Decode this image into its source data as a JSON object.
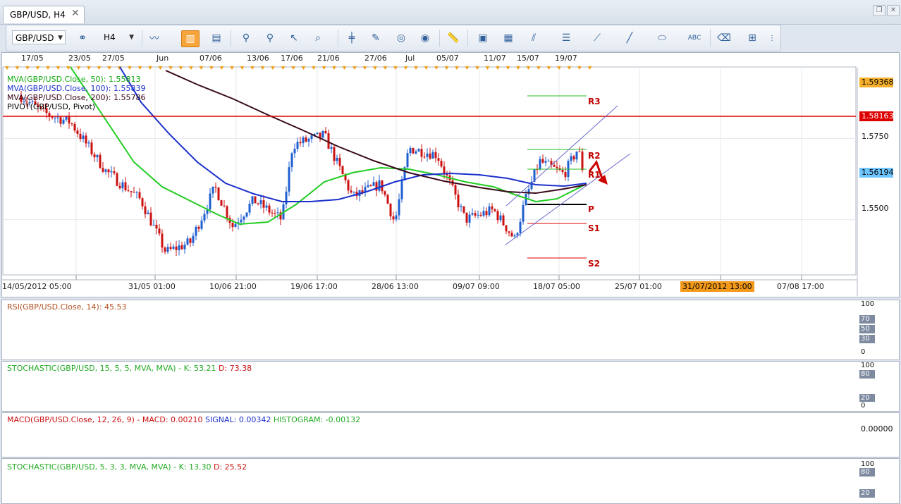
{
  "window": {
    "tab_title": "GBP/USD, H4",
    "tab_close": "✕"
  },
  "toolbar": {
    "instrument": "GBP/USD",
    "timeframe": "H4",
    "icons": [
      "link-icon",
      "chart-type-icon",
      "candles-icon",
      "bars-icon",
      "magnet-icon",
      "magnet-off-icon",
      "cursor-icon",
      "zoom-icon",
      "crosshair-icon",
      "pen-icon",
      "layers-icon",
      "globe-icon",
      "ruler-icon",
      "image-icon",
      "screenshot-icon",
      "trend-tool-icon",
      "channel-tool-icon",
      "fan-tool-icon",
      "line-tool-icon",
      "ellipse-tool-icon",
      "text-tool-icon",
      "eraser-icon",
      "tree-icon"
    ]
  },
  "main_chart": {
    "top_dates": [
      "17/05",
      "23/05",
      "27/05",
      "Jun",
      "07/06",
      "13/06",
      "17/06",
      "21/06",
      "27/06",
      "Jul",
      "05/07",
      "11/07",
      "15/07",
      "19/07"
    ],
    "bottom_dates": [
      "14/05/2012 05:00",
      "31/05 01:00",
      "10/06 21:00",
      "19/06 17:00",
      "28/06 13:00",
      "09/07 09:00",
      "18/07 05:00",
      "25/07 01:00",
      "07/08 17:00"
    ],
    "current_time_label": "31/07/2012 13:00",
    "legend": [
      {
        "text": "MVA(GBP/USD.Close, 50): 1.55813",
        "color": "#00aa00"
      },
      {
        "text": "MVA(GBP/USD.Close, 100): 1.55839",
        "color": "#0000aa"
      },
      {
        "text": "MVA(GBP/USD.Close, 200): 1.55786",
        "color": "#330011"
      },
      {
        "text": "PIVOT(GBP/USD, Pivot)",
        "color": "#000000"
      }
    ],
    "price_badges": [
      {
        "text": "1.59368",
        "bg": "#f6b02c",
        "fg": "#000"
      },
      {
        "text": "1.58163",
        "bg": "#dd0000",
        "fg": "#fff"
      },
      {
        "text": "1.56194",
        "bg": "#6fc6ff",
        "fg": "#000"
      }
    ],
    "y_ticks": [
      "1.5750",
      "1.5500"
    ],
    "pivot_labels": [
      "R3",
      "R2",
      "R1",
      "P",
      "S1",
      "S2"
    ]
  },
  "chart_data": [
    {
      "type": "candlestick",
      "title": "GBP/USD, H4",
      "x": [
        "14/05",
        "17/05",
        "23/05",
        "27/05",
        "31/05",
        "Jun",
        "07/06",
        "10/06",
        "13/06",
        "17/06",
        "19/06",
        "21/06",
        "27/06",
        "28/06",
        "Jul",
        "05/07",
        "09/07",
        "11/07",
        "15/07",
        "18/07",
        "19/07"
      ],
      "close": [
        1.588,
        1.583,
        1.57,
        1.562,
        1.547,
        1.54,
        1.548,
        1.558,
        1.554,
        1.553,
        1.574,
        1.564,
        1.556,
        1.556,
        1.569,
        1.558,
        1.548,
        1.55,
        1.558,
        1.566,
        1.5619
      ],
      "ylim": [
        1.533,
        1.597
      ],
      "series": [
        {
          "name": "MVA(GBP/USD.Close, 50)",
          "value": 1.55813
        },
        {
          "name": "MVA(GBP/USD.Close, 100)",
          "value": 1.55839
        },
        {
          "name": "MVA(GBP/USD.Close, 200)",
          "value": 1.55786
        }
      ],
      "horizontal_lines": [
        1.59368,
        1.58163,
        1.56194
      ]
    },
    {
      "type": "line",
      "title": "RSI(GBP/USD.Close, 14): 45.53",
      "series": [
        {
          "name": "RSI",
          "last": 45.53
        }
      ],
      "ylim": [
        0,
        100
      ],
      "levels": [
        30,
        50,
        70
      ]
    },
    {
      "type": "line",
      "title": "STOCHASTIC(GBP/USD, 15, 5, 5, MVA, MVA) - K: 53.21 D: 73.38",
      "series": [
        {
          "name": "K",
          "last": 53.21
        },
        {
          "name": "D",
          "last": 73.38
        }
      ],
      "ylim": [
        0,
        100
      ],
      "levels": [
        20,
        80
      ]
    },
    {
      "type": "line",
      "title": "MACD(GBP/USD.Close, 12, 26, 9) - MACD: 0.00210 SIGNAL: 0.00342 HISTOGRAM: -0.00132",
      "series": [
        {
          "name": "MACD",
          "last": 0.0021
        },
        {
          "name": "SIGNAL",
          "last": 0.00342
        },
        {
          "name": "HISTOGRAM",
          "last": -0.00132
        }
      ],
      "zero_label": "0.00000"
    },
    {
      "type": "line",
      "title": "STOCHASTIC(GBP/USD, 5, 3, 3, MVA, MVA) - K: 13.30 D: 25.52",
      "series": [
        {
          "name": "K",
          "last": 13.3
        },
        {
          "name": "D",
          "last": 25.52
        }
      ],
      "ylim": [
        0,
        100
      ],
      "levels": [
        20,
        80
      ]
    }
  ],
  "indicators": {
    "rsi": {
      "prefix": "RSI(GBP/USD.Close, 14): 45.53",
      "axis": [
        "100",
        "70",
        "50",
        "30",
        "0"
      ]
    },
    "stoch1": {
      "prefix": "STOCHASTIC(GBP/USD, 15, 5, 5, MVA, MVA) -",
      "k": "K: 53.21",
      "d": "D: 73.38",
      "axis": [
        "100",
        "80",
        "20",
        "0"
      ]
    },
    "macd": {
      "prefix": "MACD(GBP/USD.Close, 12, 26, 9) -",
      "macd": "MACD: 0.00210",
      "signal": "SIGNAL: 0.00342",
      "hist": "HISTOGRAM: -0.00132",
      "axis": [
        "0.00000"
      ]
    },
    "stoch2": {
      "prefix": "STOCHASTIC(GBP/USD, 5, 3, 3, MVA, MVA) -",
      "k": "K: 13.30",
      "d": "D: 25.52",
      "axis": [
        "100",
        "80",
        "20"
      ]
    }
  },
  "colors": {
    "bull": "#1f5fd0",
    "bear": "#cc1111",
    "ma50": "#22cc22",
    "ma100": "#1a2fcc",
    "ma200": "#3a0a1a",
    "resistance": "#dd0000",
    "pivot_green": "#22bb22",
    "rsi": "#b05020",
    "stoch_k": "#22cc22",
    "stoch_d": "#cc1111"
  }
}
